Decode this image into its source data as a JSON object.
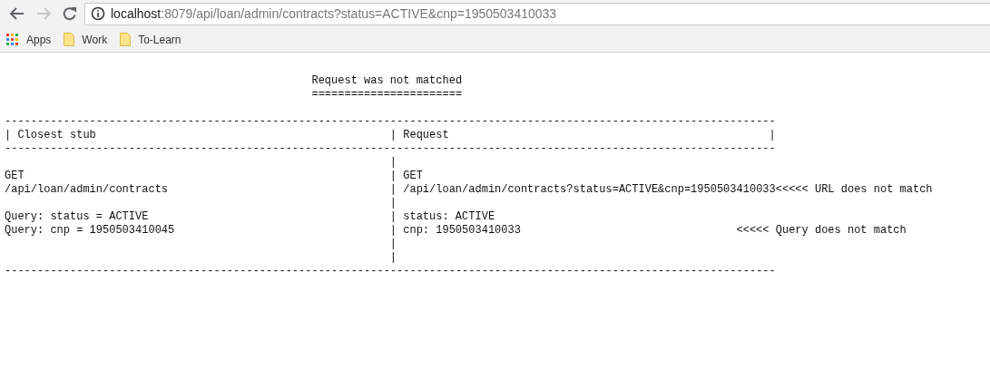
{
  "browser": {
    "url_host": "localhost",
    "url_rest": ":8079/api/loan/admin/contracts?status=ACTIVE&cnp=1950503410033",
    "bookmarks": [
      {
        "label": "Apps",
        "kind": "apps"
      },
      {
        "label": "Work",
        "kind": "folder"
      },
      {
        "label": "To-Learn",
        "kind": "folder"
      }
    ]
  },
  "page": {
    "heading": "Request was not matched",
    "underline": "=======================",
    "top_rule": "----------------------------------------------------------------------------------------------------------------------",
    "header": {
      "left": "| Closest stub",
      "right": "| Request",
      "end": "|"
    },
    "mid_rule": "----------------------------------------------------------------------------------------------------------------------",
    "rows": [
      {
        "right": "|"
      },
      {
        "left": "GET",
        "right": "| GET"
      },
      {
        "left": "/api/loan/admin/contracts",
        "right": "| /api/loan/admin/contracts?status=ACTIVE&cnp=1950503410033<<<<< URL does not match"
      },
      {
        "right": "|"
      },
      {
        "left": "Query: status = ACTIVE",
        "right": "| status: ACTIVE"
      },
      {
        "left": "Query: cnp = 1950503410045",
        "right": "| cnp: 1950503410033",
        "note": "<<<<< Query does not match"
      },
      {
        "right": "|"
      },
      {
        "right": "|"
      }
    ],
    "bottom_rule": "----------------------------------------------------------------------------------------------------------------------"
  }
}
